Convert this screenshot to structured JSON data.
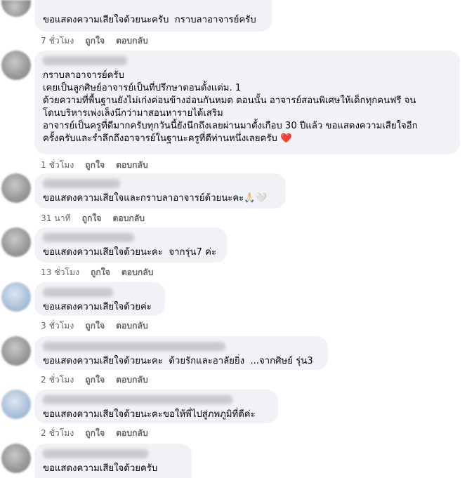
{
  "comments": [
    {
      "text": "ขอแสดงความเสียใจด้วยนะครับ  กราบลาอาจารย์ครับ",
      "time": "7 ชั่วโมง",
      "like": "ถูกใจ",
      "reply": "ตอบกลับ"
    },
    {
      "text": "กราบลาอาจารย์ครับ\nเคยเป็นลูกศิษย์อาจารย์เป็นที่ปรึกษาตอนตั้งแต่ม. 1\nด้วยความที่พื้นฐานยังไม่เก่งค่อนข้างอ่อนกันหมด ตอนนั้น อาจารย์สอนพิเศษให้เด็กทุกคนฟรี จน\nโดนบริหารเพ่งเล็งนึกว่ามาสอนหารายได้เสริม\nอาจารย์เป็นครูที่ดีมากครับทุกวันนี้ยังนึกถึงเลยผ่านมาตั้งเกือบ 30 ปีแล้ว ขอแสดงความเสียใจอีก\nครั้งครับและรำลึกถึงอาจารย์ในฐานะครูที่ดีท่านหนึ่งเลยครับ",
      "emoji": "❤️",
      "time": "1 ชั่วโมง",
      "like": "ถูกใจ",
      "reply": "ตอบกลับ"
    },
    {
      "text": "ขอแสดงความเสียใจและกราบลาอาจารย์ด้วยนะคะ",
      "emoji": "🙏🏻🤍",
      "time": "31 นาที",
      "like": "ถูกใจ",
      "reply": "ตอบกลับ"
    },
    {
      "text": "ขอแสดงความเสียใจด้วยนะคะ  จากรุ่น7 ค่ะ",
      "time": "13 ชั่วโมง",
      "like": "ถูกใจ",
      "reply": "ตอบกลับ"
    },
    {
      "text": "ขอแสดงความเสียใจด้วยค่ะ",
      "time": "3 ชั่วโมง",
      "like": "ถูกใจ",
      "reply": "ตอบกลับ"
    },
    {
      "text": "ขอแสดงความเสียใจด้วยนะคะ  ด้วยรักและอาลัยยิ่ง  ...จากศิษย์ รุ่น3",
      "time": "2 ชั่วโมง",
      "like": "ถูกใจ",
      "reply": "ตอบกลับ"
    },
    {
      "text": "ขอแสดงความเสียใจด้วยนะคะขอให้พี่ไปสู่ภพภูมิที่ดีค่ะ",
      "time": "2 ชั่วโมง",
      "like": "ถูกใจ",
      "reply": "ตอบกลับ"
    },
    {
      "text": "ขอแสดงความเสียใจด้วยครับ",
      "time": "",
      "like": "",
      "reply": ""
    }
  ]
}
